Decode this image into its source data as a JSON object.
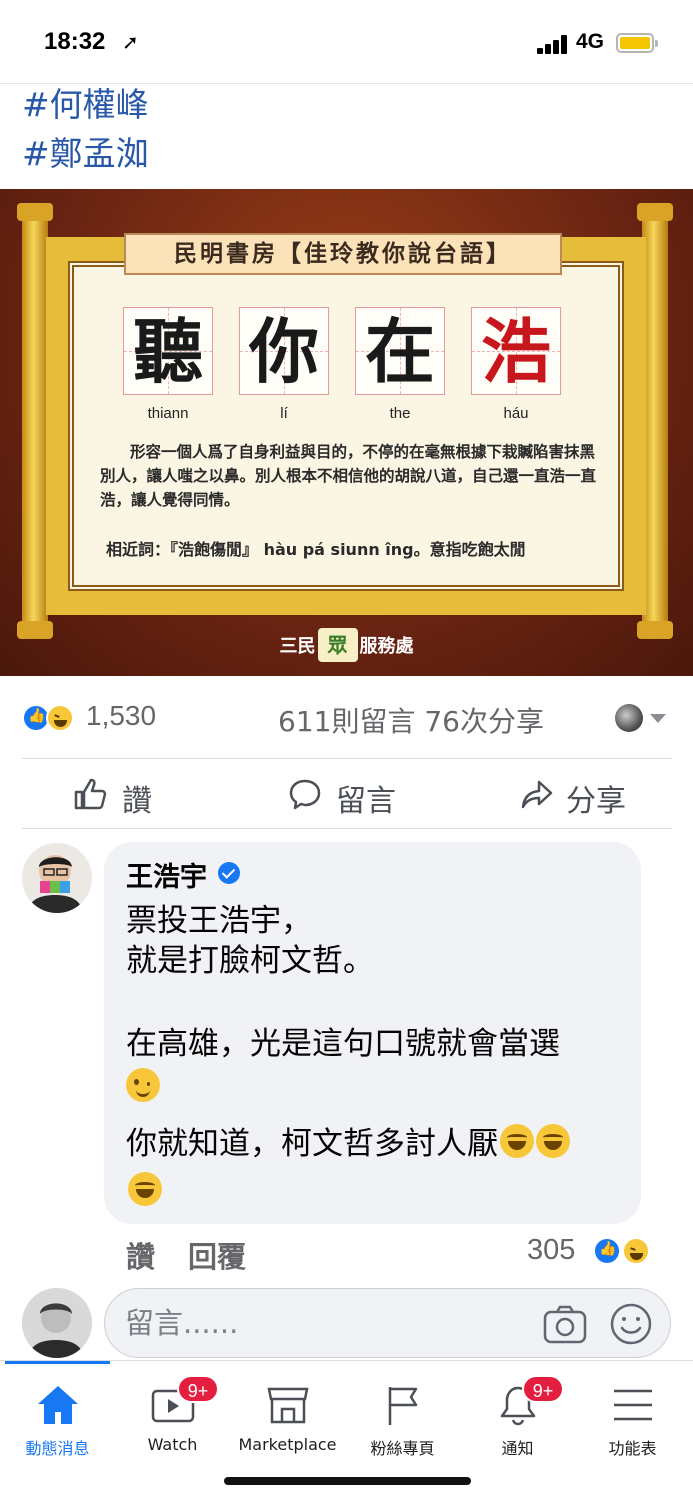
{
  "status_bar": {
    "time": "18:32",
    "location_icon": "location-arrow-icon",
    "network": "4G",
    "accent_battery": "#f4c500"
  },
  "post": {
    "hashtags": [
      "#何權峰",
      "#鄭孟洳"
    ],
    "image": {
      "title": "民明書房【佳玲教你說台語】",
      "characters": [
        "聽",
        "你",
        "在",
        "浩"
      ],
      "romanization": [
        "thiann",
        "lí",
        "the",
        "háu"
      ],
      "description": "形容一個人爲了自身利益與目的，不停的在毫無根據下栽贓陷害抹黑別人，讓人嗤之以鼻。別人根本不相信他的胡說八道，自己還一直浩一直浩，讓人覺得同情。",
      "synonym": "相近詞：『浩飽傷閒』 hàu pá siunn îng。意指吃飽太閒",
      "brand_left": "三民",
      "brand_logo": "眾",
      "brand_right": "服務處"
    },
    "reactions": {
      "count": "1,530",
      "comments": "611則留言",
      "shares": "76次分享"
    },
    "actions": {
      "like": "讚",
      "comment": "留言",
      "share": "分享"
    }
  },
  "comment": {
    "author": "王浩宇",
    "lines": [
      "票投王浩宇，",
      "就是打臉柯文哲。",
      "在高雄，光是這句口號就會當選",
      "你就知道，柯文哲多討人厭"
    ],
    "like_label": "讚",
    "reply_label": "回覆",
    "reaction_count": "305"
  },
  "compose": {
    "placeholder": "留言......"
  },
  "tabbar": {
    "tabs": [
      {
        "label": "動態消息",
        "icon": "home-icon"
      },
      {
        "label": "Watch",
        "icon": "watch-video-icon",
        "badge": "9+"
      },
      {
        "label": "Marketplace",
        "icon": "marketplace-shop-icon"
      },
      {
        "label": "粉絲專頁",
        "icon": "flag-icon"
      },
      {
        "label": "通知",
        "icon": "bell-icon",
        "badge": "9+"
      },
      {
        "label": "功能表",
        "icon": "menu-icon"
      }
    ]
  },
  "colors": {
    "brand_blue": "#1877f2",
    "hashtag_blue": "#2a58a8",
    "badge_red": "#e41e3f"
  }
}
